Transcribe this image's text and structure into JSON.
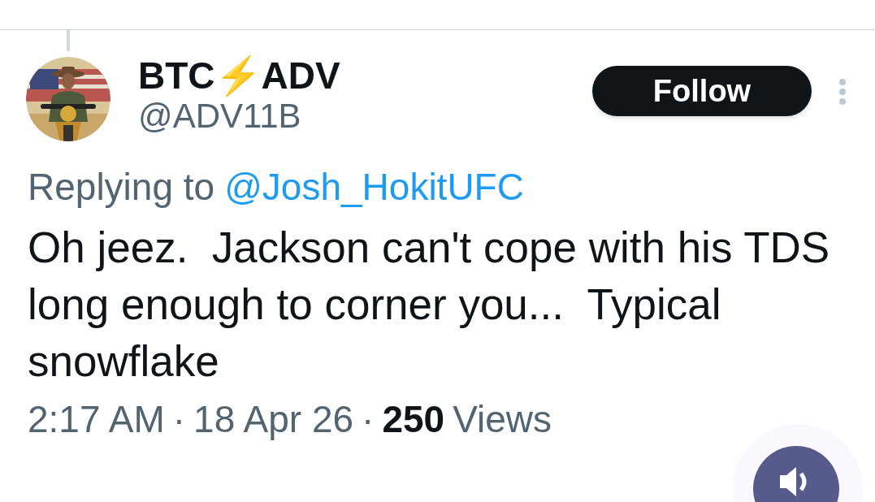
{
  "author": {
    "name": "BTC⚡ADV",
    "handle": "@ADV11B"
  },
  "follow_button": {
    "label": "Follow"
  },
  "reply_context": {
    "prefix": "Replying to",
    "mention": "@Josh_HokitUFC"
  },
  "post": {
    "text": "Oh jeez.  Jackson can't cope with his TDS long enough to corner you...  Typical snowflake"
  },
  "footer": [
    {
      "kind": "text",
      "text": "2:17 AM"
    },
    {
      "kind": "separator",
      "text": "·"
    },
    {
      "kind": "text",
      "text": "18 Apr 26"
    },
    {
      "kind": "separator",
      "text": "·"
    },
    {
      "kind": "count",
      "text": "250"
    },
    {
      "kind": "text",
      "text": "Views"
    }
  ]
}
